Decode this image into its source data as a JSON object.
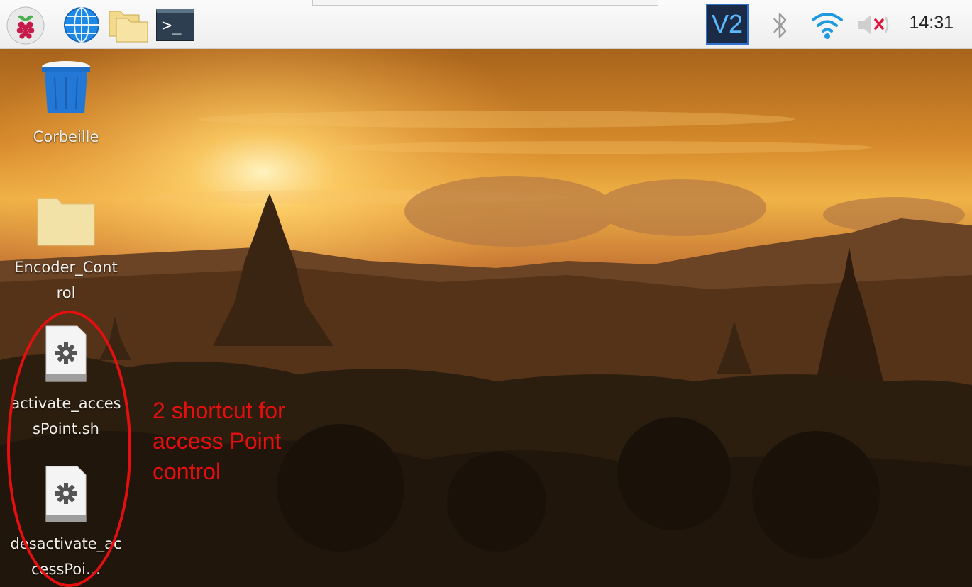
{
  "taskbar": {
    "clock": "14:31",
    "icons": [
      "raspberry-menu-icon",
      "browser-globe-icon",
      "file-manager-folder-icon",
      "terminal-icon"
    ],
    "terminal_prompt": ">_",
    "tray": [
      "vnc-icon",
      "bluetooth-icon",
      "wifi-icon",
      "volume-muted-icon"
    ],
    "vnc_label": "V2"
  },
  "desktop": {
    "icons": [
      {
        "label": "Corbeille",
        "icon": "trash-icon"
      },
      {
        "label": "Encoder_Control",
        "icon": "folder-icon"
      },
      {
        "label": "activate_accessPoint.sh",
        "icon": "script-file-icon"
      },
      {
        "label": "desactivate_accessPoi…",
        "icon": "script-file-icon"
      }
    ]
  },
  "annotation": {
    "text_line1": "2 shortcut for",
    "text_line2": "access Point",
    "text_line3": "control",
    "color": "#e60f0f"
  },
  "colors": {
    "accent_blue": "#1e88e5",
    "vnc_bg": "#1c2b45",
    "wifi": "#1e9be0"
  }
}
